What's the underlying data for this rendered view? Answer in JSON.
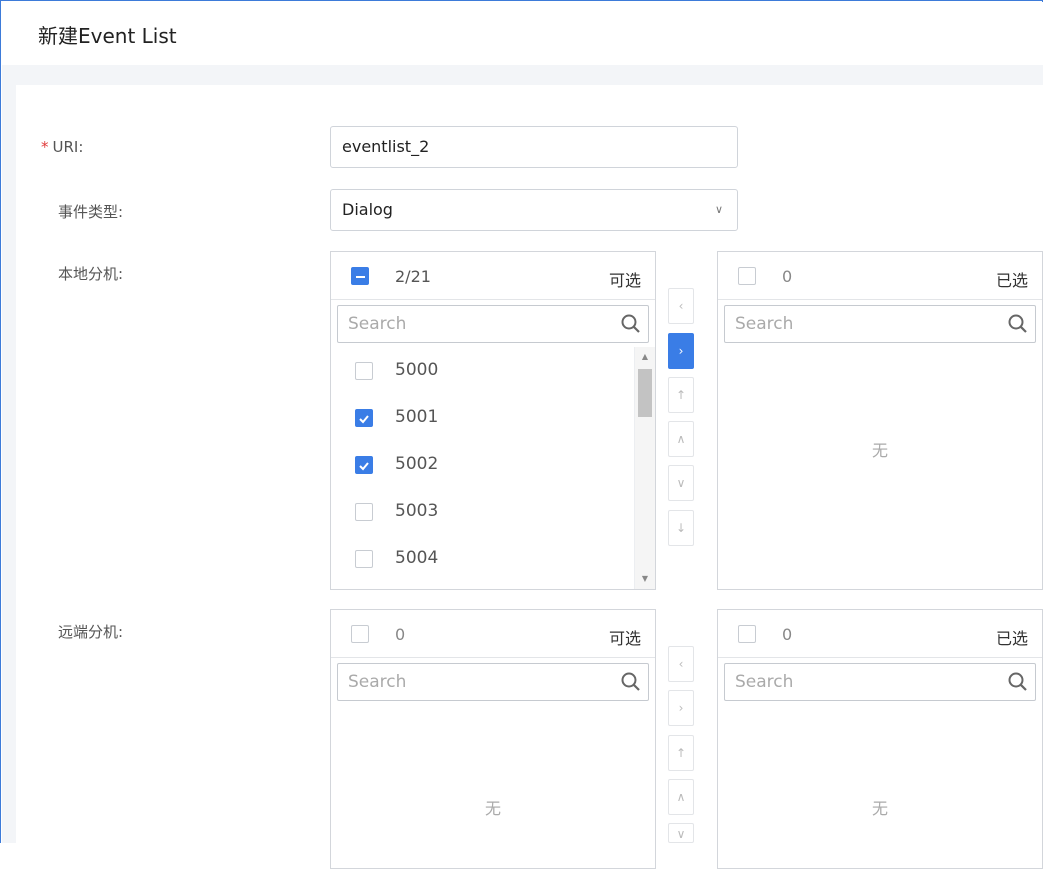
{
  "dialog": {
    "title": "新建Event List"
  },
  "form": {
    "uri": {
      "required_mark": "*",
      "label": "URI:",
      "value": "eventlist_2"
    },
    "event_type": {
      "label": "事件类型:",
      "value": "Dialog"
    }
  },
  "local_ext": {
    "label": "本地分机:",
    "available": {
      "count": "2/21",
      "title": "可选",
      "search_placeholder": "Search",
      "items": [
        {
          "label": "5000",
          "checked": false
        },
        {
          "label": "5001",
          "checked": true
        },
        {
          "label": "5002",
          "checked": true
        },
        {
          "label": "5003",
          "checked": false
        },
        {
          "label": "5004",
          "checked": false
        }
      ]
    },
    "selected": {
      "count": "0",
      "title": "已选",
      "search_placeholder": "Search",
      "empty": "无"
    }
  },
  "remote_ext": {
    "label": "远端分机:",
    "available": {
      "count": "0",
      "title": "可选",
      "search_placeholder": "Search",
      "empty": "无"
    },
    "selected": {
      "count": "0",
      "title": "已选",
      "search_placeholder": "Search",
      "empty": "无"
    }
  },
  "colors": {
    "accent": "#3a7de6",
    "required": "#e03b3b"
  },
  "icons": {
    "search": "search-icon",
    "dropdown": "chevron-down-icon",
    "move_left": "chevron-left-icon",
    "move_right": "chevron-right-icon",
    "move_top": "arrow-up-icon",
    "move_up": "chevron-up-icon",
    "move_down": "chevron-down-icon",
    "move_bottom": "arrow-down-icon"
  }
}
